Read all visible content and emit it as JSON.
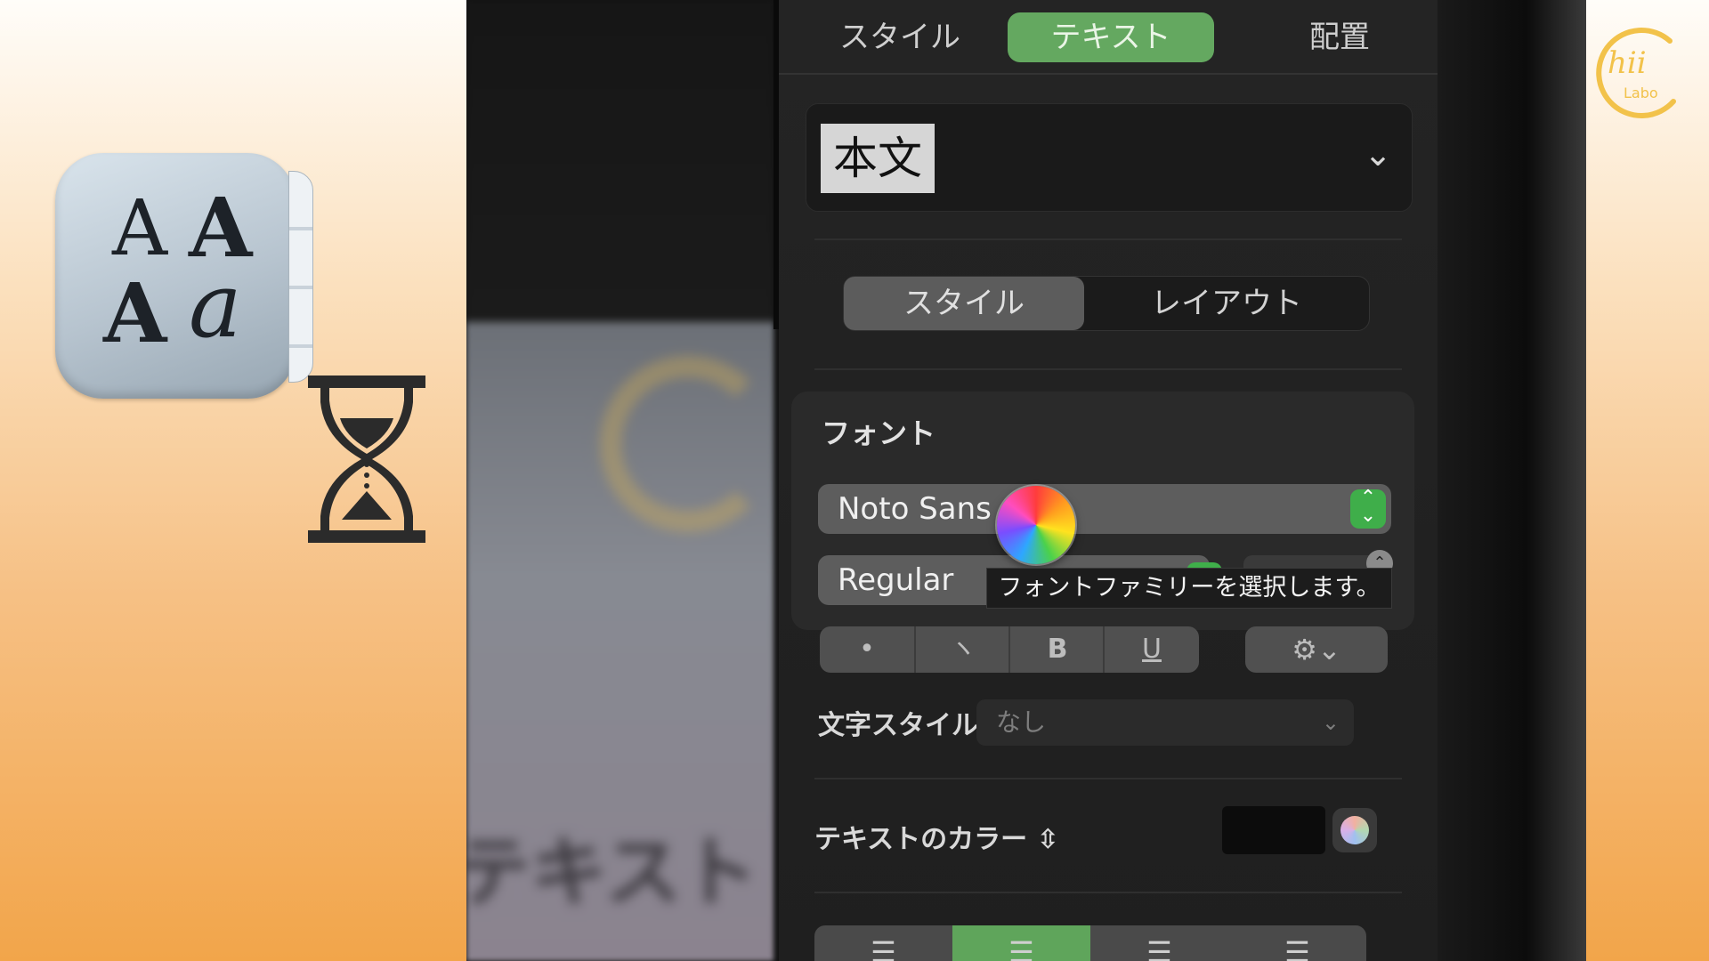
{
  "inspector": {
    "tabs": [
      "スタイル",
      "テキスト",
      "配置"
    ],
    "active_tab": "テキスト",
    "paragraph_style": "本文",
    "segments": [
      "スタイル",
      "レイアウト"
    ],
    "active_segment": "スタイル",
    "font_section_title": "フォント",
    "font_family": "Noto Sans",
    "typeface": "Regular",
    "tooltip": "フォントファミリーを選択します。",
    "format_buttons": [
      "•",
      "ヽ",
      "B",
      "U"
    ],
    "character_style_label": "文字スタイル",
    "character_style_value": "なし",
    "text_color_label": "テキストのカラー",
    "text_color_stepper": "⇳"
  },
  "background_document_text": "テキスト",
  "logo": {
    "line1": "hii",
    "line2": "Labo"
  },
  "colors": {
    "accent_green": "#64a860",
    "panel_bg": "#242424",
    "popup_bg": "#5d5d5d"
  },
  "icons": [
    "font-book-icon",
    "hourglass-icon",
    "chevron-down-icon",
    "gear-icon",
    "spinning-wait-cursor-icon",
    "color-well-icon"
  ]
}
